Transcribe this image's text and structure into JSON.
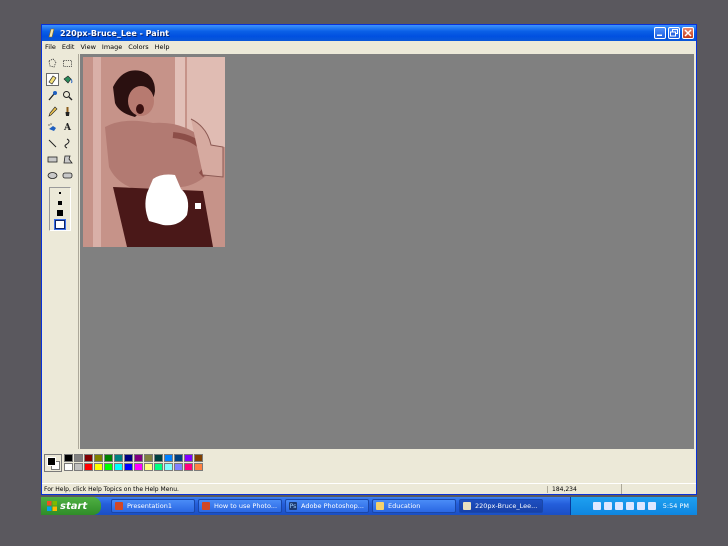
{
  "window": {
    "title": "220px-Bruce_Lee - Paint",
    "icon": "paint-brush-icon"
  },
  "menubar": {
    "items": [
      "File",
      "Edit",
      "View",
      "Image",
      "Colors",
      "Help"
    ]
  },
  "toolbox": {
    "tools": [
      {
        "name": "free-form-select-icon",
        "glyph": "⬠"
      },
      {
        "name": "rect-select-icon",
        "glyph": "▭"
      },
      {
        "name": "eraser-icon",
        "glyph": "◇"
      },
      {
        "name": "fill-icon",
        "glyph": "◉"
      },
      {
        "name": "color-picker-icon",
        "glyph": "╱"
      },
      {
        "name": "magnifier-icon",
        "glyph": "⚲"
      },
      {
        "name": "pencil-icon",
        "glyph": "✎"
      },
      {
        "name": "brush-icon",
        "glyph": "♙"
      },
      {
        "name": "airbrush-icon",
        "glyph": "⛁"
      },
      {
        "name": "text-icon",
        "glyph": "A"
      },
      {
        "name": "line-icon",
        "glyph": "╲"
      },
      {
        "name": "curve-icon",
        "glyph": "⌇"
      },
      {
        "name": "rectangle-icon",
        "glyph": "▭"
      },
      {
        "name": "polygon-icon",
        "glyph": "⏢"
      },
      {
        "name": "ellipse-icon",
        "glyph": "◯"
      },
      {
        "name": "rounded-rect-icon",
        "glyph": "▢"
      }
    ],
    "selected_tool": "eraser-icon"
  },
  "palette": {
    "foreground": "#000000",
    "background": "#ffffff",
    "row1": [
      "#000000",
      "#808080",
      "#800000",
      "#808000",
      "#008000",
      "#008080",
      "#000080",
      "#800080",
      "#808040",
      "#004040",
      "#0080ff",
      "#004080",
      "#8000ff",
      "#804000"
    ],
    "row2": [
      "#ffffff",
      "#c0c0c0",
      "#ff0000",
      "#ffff00",
      "#00ff00",
      "#00ffff",
      "#0000ff",
      "#ff00ff",
      "#ffff80",
      "#00ff80",
      "#80ffff",
      "#8080ff",
      "#ff0080",
      "#ff8040"
    ]
  },
  "statusbar": {
    "help_text": "For Help, click Help Topics on the Help Menu.",
    "coords": "184,234"
  },
  "taskbar": {
    "start_label": "start",
    "tasks": [
      {
        "label": "Presentation1",
        "icon": "powerpoint-icon",
        "color": "#d24726"
      },
      {
        "label": "How to use Photo...",
        "icon": "powerpoint-icon",
        "color": "#d24726"
      },
      {
        "label": "Adobe Photoshop...",
        "icon": "photoshop-icon",
        "color": "#1c3a70"
      },
      {
        "label": "Education",
        "icon": "folder-icon",
        "color": "#f5d26b"
      },
      {
        "label": "220px-Bruce_Lee...",
        "icon": "paint-icon",
        "color": "#e8e0c0",
        "active": true
      }
    ],
    "clock": "5:54 PM"
  }
}
